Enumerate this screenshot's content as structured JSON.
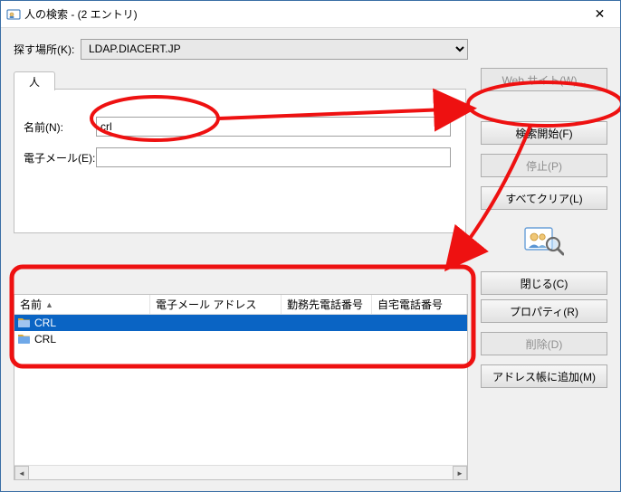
{
  "window": {
    "title": "人の検索 - (2 エントリ)"
  },
  "lookin": {
    "label": "探す場所(K):",
    "value": "LDAP.DIACERT.JP"
  },
  "tabs": {
    "people": "人"
  },
  "fields": {
    "name_label": "名前(N):",
    "name_value": "crl",
    "email_label": "電子メール(E):",
    "email_value": ""
  },
  "buttons": {
    "website": "Web サイト(W)...",
    "find": "検索開始(F)",
    "stop": "停止(P)",
    "clear": "すべてクリア(L)",
    "close": "閉じる(C)",
    "properties": "プロパティ(R)",
    "delete": "削除(D)",
    "add": "アドレス帳に追加(M)"
  },
  "results": {
    "headers": {
      "name": "名前",
      "email": "電子メール アドレス",
      "bus_phone": "勤務先電話番号",
      "home_phone": "自宅電話番号"
    },
    "rows": [
      {
        "name": "CRL",
        "selected": true
      },
      {
        "name": "CRL",
        "selected": false
      }
    ]
  }
}
